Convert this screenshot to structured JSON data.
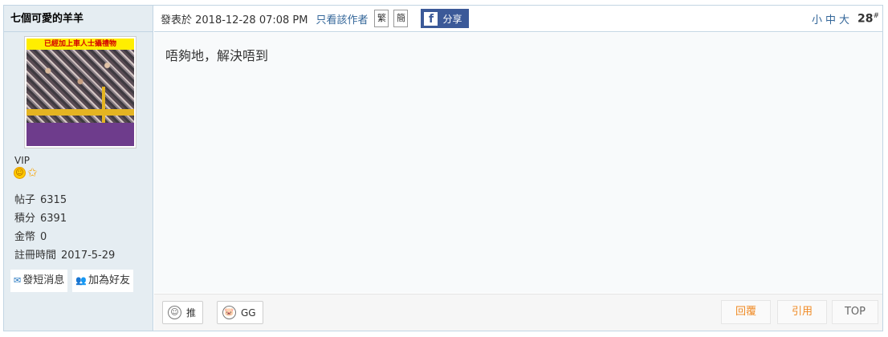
{
  "author": {
    "name": "七個可愛的羊羊",
    "avatar_banner": "已經加上車人士攝禮物",
    "group": "VIP",
    "badges": [
      "smile-icon",
      "star-icon"
    ],
    "stats": [
      {
        "label": "帖子",
        "value": "6315"
      },
      {
        "label": "積分",
        "value": "6391"
      },
      {
        "label": "金幣",
        "value": "0"
      },
      {
        "label": "註冊時間",
        "value": "2017-5-29"
      }
    ],
    "actions": {
      "message": "發短消息",
      "add_friend": "加為好友"
    }
  },
  "meta": {
    "posted": "發表於 2018-12-28 07:08 PM",
    "only_author": "只看該作者",
    "traditional": "繁",
    "simplified": "簡",
    "share": "分享",
    "font_sizes": "小中大",
    "floor": "28",
    "floor_mark": "#"
  },
  "content": {
    "message": "唔夠地，解決唔到"
  },
  "footer": {
    "vote_up": "推",
    "vote_down": "GG",
    "reply": "回覆",
    "quote": "引用",
    "top": "TOP"
  },
  "colors": {
    "sidebar_bg": "#e5edf2",
    "border": "#c2d5e3",
    "link": "#336699",
    "facebook": "#3b5998",
    "accent_orange": "#f08a24"
  }
}
